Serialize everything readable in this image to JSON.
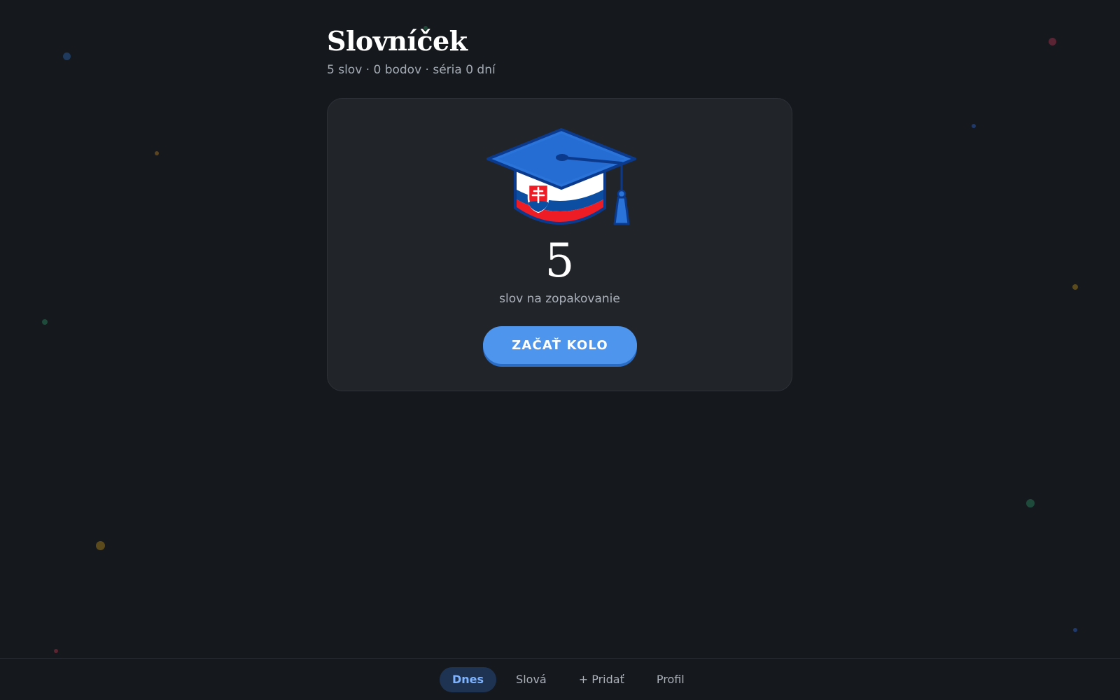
{
  "header": {
    "title": "Slovníček",
    "stats": "5 slov · 0 bodov · séria 0 dní"
  },
  "review_card": {
    "icon": "graduation-cap-slovak-flag-icon",
    "due_count": "5",
    "due_label": "slov na zopakovanie",
    "start_label": "ZAČAŤ KOLO"
  },
  "nav": {
    "items": [
      {
        "label": "Dnes",
        "active": true
      },
      {
        "label": "Slová",
        "active": false
      },
      {
        "label": "+ Pridať",
        "active": false
      },
      {
        "label": "Profil",
        "active": false
      }
    ]
  },
  "colors": {
    "background": "#15181c",
    "card": "#212429",
    "accent": "#4e95ee",
    "nav_active_bg": "#1e3352",
    "nav_active_text": "#7db3ff",
    "flag_white": "#ffffff",
    "flag_blue": "#0b4ea2",
    "flag_red": "#ee1c25"
  }
}
